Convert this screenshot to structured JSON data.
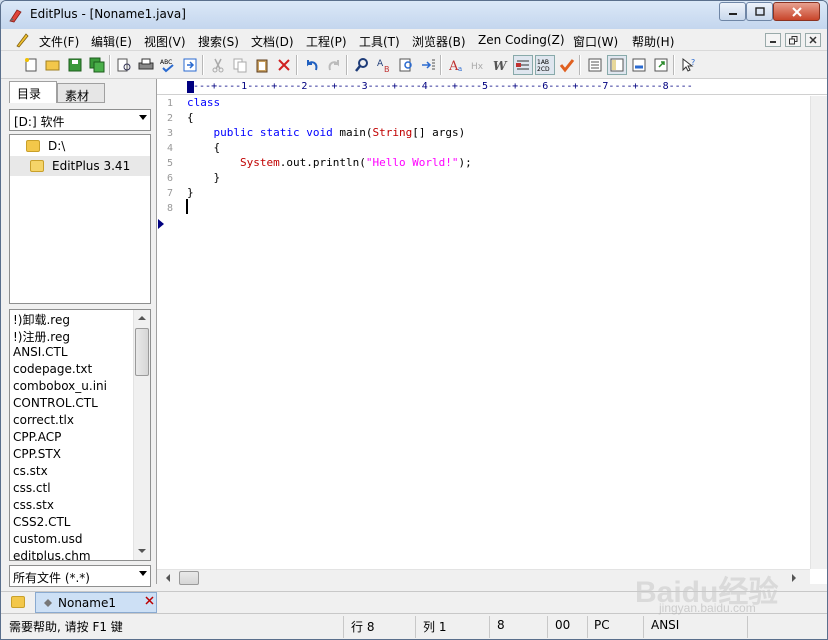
{
  "window": {
    "title": "EditPlus - [Noname1.java]"
  },
  "menu": {
    "items": [
      "文件(F)",
      "编辑(E)",
      "视图(V)",
      "搜索(S)",
      "文档(D)",
      "工程(P)",
      "工具(T)",
      "浏览器(B)",
      "Zen Coding(Z)",
      "窗口(W)",
      "帮助(H)"
    ]
  },
  "sidebar": {
    "tabs": [
      "目录",
      "素材"
    ],
    "drive": "[D:] 软件",
    "tree": [
      "D:\\",
      "EditPlus 3.41"
    ],
    "files": [
      "!)卸载.reg",
      "!)注册.reg",
      "ANSI.CTL",
      "codepage.txt",
      "combobox_u.ini",
      "CONTROL.CTL",
      "correct.tlx",
      "CPP.ACP",
      "CPP.STX",
      "cs.stx",
      "css.ctl",
      "css.stx",
      "CSS2.CTL",
      "custom.usd",
      "editplus.chm"
    ],
    "filter": "所有文件 (*.*)"
  },
  "editor": {
    "ruler": "----+----1----+----2----+----3----+----4----+----5----+----6----+----7----+----8----",
    "line_numbers": [
      "1",
      "2",
      "3",
      "4",
      "5",
      "6",
      "7",
      "8"
    ],
    "code": {
      "l1": "class",
      "l2": "{",
      "l3_kw": "public static void",
      "l3_rest": " main(",
      "l3_type": "String",
      "l3_end": "[] args)",
      "l4": "{",
      "l5_cls": "System",
      "l5_mid": ".out.println(",
      "l5_str": "\"Hello World!\"",
      "l5_end": ");",
      "l6": "}",
      "l7": "}"
    }
  },
  "doc_tab": {
    "label": "Noname1"
  },
  "statusbar": {
    "help": "需要帮助, 请按 F1 键",
    "row": "行 8",
    "col": "列 1",
    "val1": "8",
    "val2": "00",
    "mode": "PC",
    "encoding": "ANSI"
  },
  "watermark": {
    "main": "Baidu经验",
    "sub": "jingyan.baidu.com"
  },
  "colors": {
    "keyword": "#0000ff",
    "string": "#ff00ff",
    "class": "#c00000",
    "line_number": "#999999"
  }
}
